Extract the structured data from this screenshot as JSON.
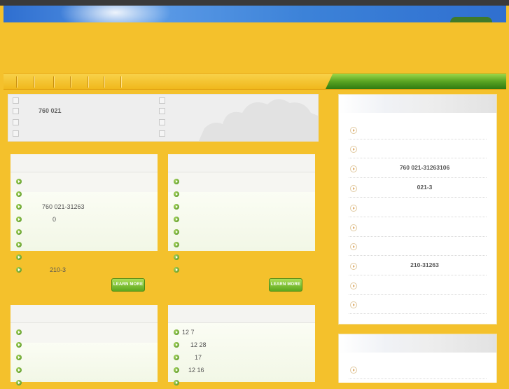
{
  "top_list": {
    "left": [
      "",
      "760  021",
      "",
      ""
    ],
    "right": [
      "",
      "",
      "",
      ""
    ]
  },
  "panel_1": {
    "items": [
      "",
      "",
      "760  021-31263",
      "0",
      "",
      "",
      "",
      "210-3"
    ],
    "learn_more": "LEARN MORE"
  },
  "panel_2": {
    "items": [
      "",
      "",
      "",
      "",
      "",
      "",
      "",
      ""
    ],
    "learn_more": "LEARN MORE"
  },
  "panel_3": {
    "items": [
      "",
      "",
      "",
      "",
      ""
    ]
  },
  "panel_4": {
    "items": [
      "12 7",
      "12 28",
      "17",
      "12 16",
      ""
    ]
  },
  "sidebar_1": {
    "items": [
      "",
      "",
      "760   021-31263106",
      "021-3",
      "",
      "",
      "",
      "210-31263",
      "",
      ""
    ]
  },
  "sidebar_2": {
    "items": [
      ""
    ]
  }
}
